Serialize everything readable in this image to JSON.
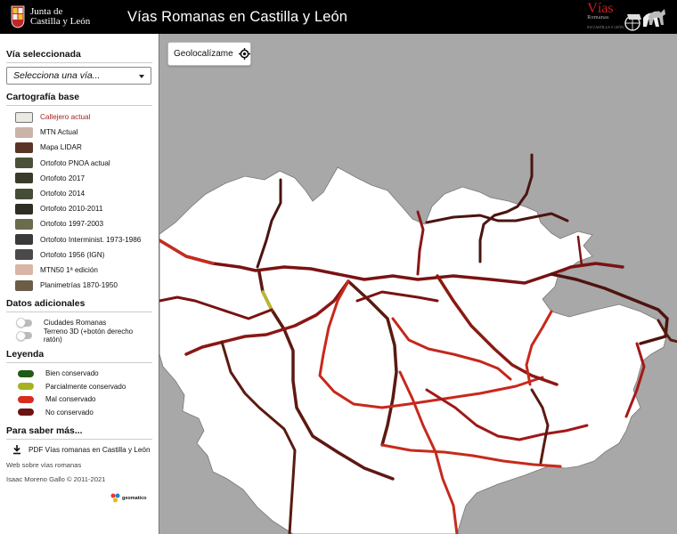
{
  "header": {
    "org_line1": "Junta de",
    "org_line2": "Castilla y León",
    "title": "Vías Romanas en Castilla y León",
    "brand_big": "Vías",
    "brand_small": "Romanas",
    "brand_sub": "EN CASTILLA Y LEÓN"
  },
  "sidebar": {
    "via_title": "Vía seleccionada",
    "via_placeholder": "Selecciona una vía...",
    "carto_title": "Cartografía base",
    "carto": [
      {
        "label": "Callejero actual",
        "color": "#ece9e3"
      },
      {
        "label": "MTN Actual",
        "color": "#c9b4a7"
      },
      {
        "label": "Mapa LIDAR",
        "color": "#5a3527"
      },
      {
        "label": "Ortofoto PNOA actual",
        "color": "#4b5138"
      },
      {
        "label": "Ortofoto 2017",
        "color": "#3b3b2b"
      },
      {
        "label": "Ortofoto 2014",
        "color": "#454d36"
      },
      {
        "label": "Ortofoto 2010-2011",
        "color": "#2e2e25"
      },
      {
        "label": "Ortofoto 1997-2003",
        "color": "#6b6b4e"
      },
      {
        "label": "Ortofoto Interminist. 1973-1986",
        "color": "#3a3a3a"
      },
      {
        "label": "Ortofoto 1956 (IGN)",
        "color": "#4a4a4a"
      },
      {
        "label": "MTN50 1ª edición",
        "color": "#d8b5a6"
      },
      {
        "label": "Planimetrías 1870-1950",
        "color": "#6b5c46"
      }
    ],
    "extra_title": "Datos adicionales",
    "extras": [
      "Ciudades Romanas",
      "Terreno 3D (+botón derecho ratón)"
    ],
    "legend_title": "Leyenda",
    "legend": [
      {
        "label": "Bien conservado",
        "color": "#1e5b14"
      },
      {
        "label": "Parcialmente conservado",
        "color": "#a8b21f"
      },
      {
        "label": "Mal conservado",
        "color": "#d92c1f"
      },
      {
        "label": "No conservado",
        "color": "#6a1414"
      }
    ],
    "more_title": "Para saber más...",
    "pdf_link": "PDF Vías romanas en Castilla y León",
    "web_link": "Web sobre vías romanas",
    "credit": "Isaac Moreno Gallo © 2011-2021",
    "geomatico": "geomatico"
  },
  "map": {
    "geolocate_label": "Geolocalízame"
  }
}
